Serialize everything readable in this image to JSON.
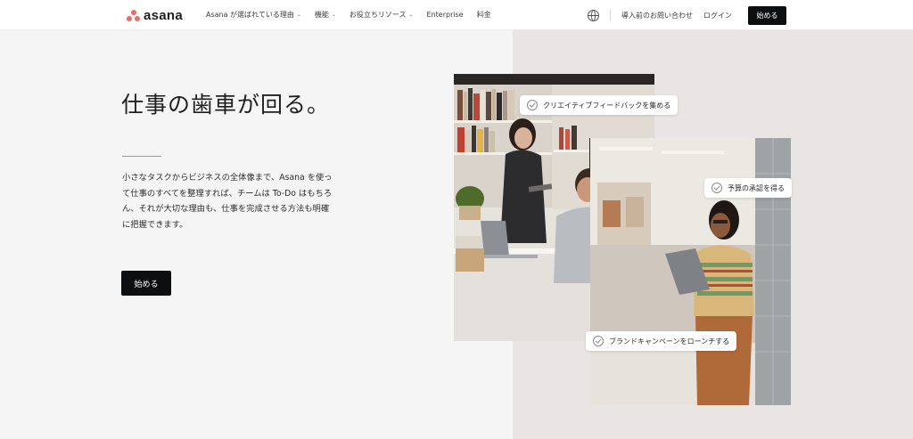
{
  "header": {
    "logo_text": "asana",
    "nav": [
      {
        "label": "Asana が選ばれている理由",
        "has_dropdown": true
      },
      {
        "label": "機能",
        "has_dropdown": true
      },
      {
        "label": "お役立ちリソース",
        "has_dropdown": true
      },
      {
        "label": "Enterprise",
        "has_dropdown": false
      },
      {
        "label": "料金",
        "has_dropdown": false
      }
    ],
    "globe_icon": "globe-icon",
    "contact_label": "導入前のお問い合わせ",
    "login_label": "ログイン",
    "start_label": "始める"
  },
  "hero": {
    "title": "仕事の歯車が回る。",
    "description": "小さなタスクからビジネスの全体像まで、Asana を使って仕事のすべてを整理すれば、チームは To-Do はもちろん、それが大切な理由も、仕事を完成させる方法も明確に把握できます。",
    "cta_label": "始める"
  },
  "chips": [
    {
      "label": "クリエイティブフィードバックを集める",
      "icon": "check-circle-icon"
    },
    {
      "label": "予算の承認を得る",
      "icon": "check-circle-icon"
    },
    {
      "label": "ブランドキャンペーンをローンチする",
      "icon": "check-circle-icon"
    }
  ],
  "colors": {
    "brand_coral": "#f06a6a",
    "button_black": "#0d0e10",
    "page_bg": "#f6f5f5",
    "panel_bg": "#e9e5e4"
  }
}
